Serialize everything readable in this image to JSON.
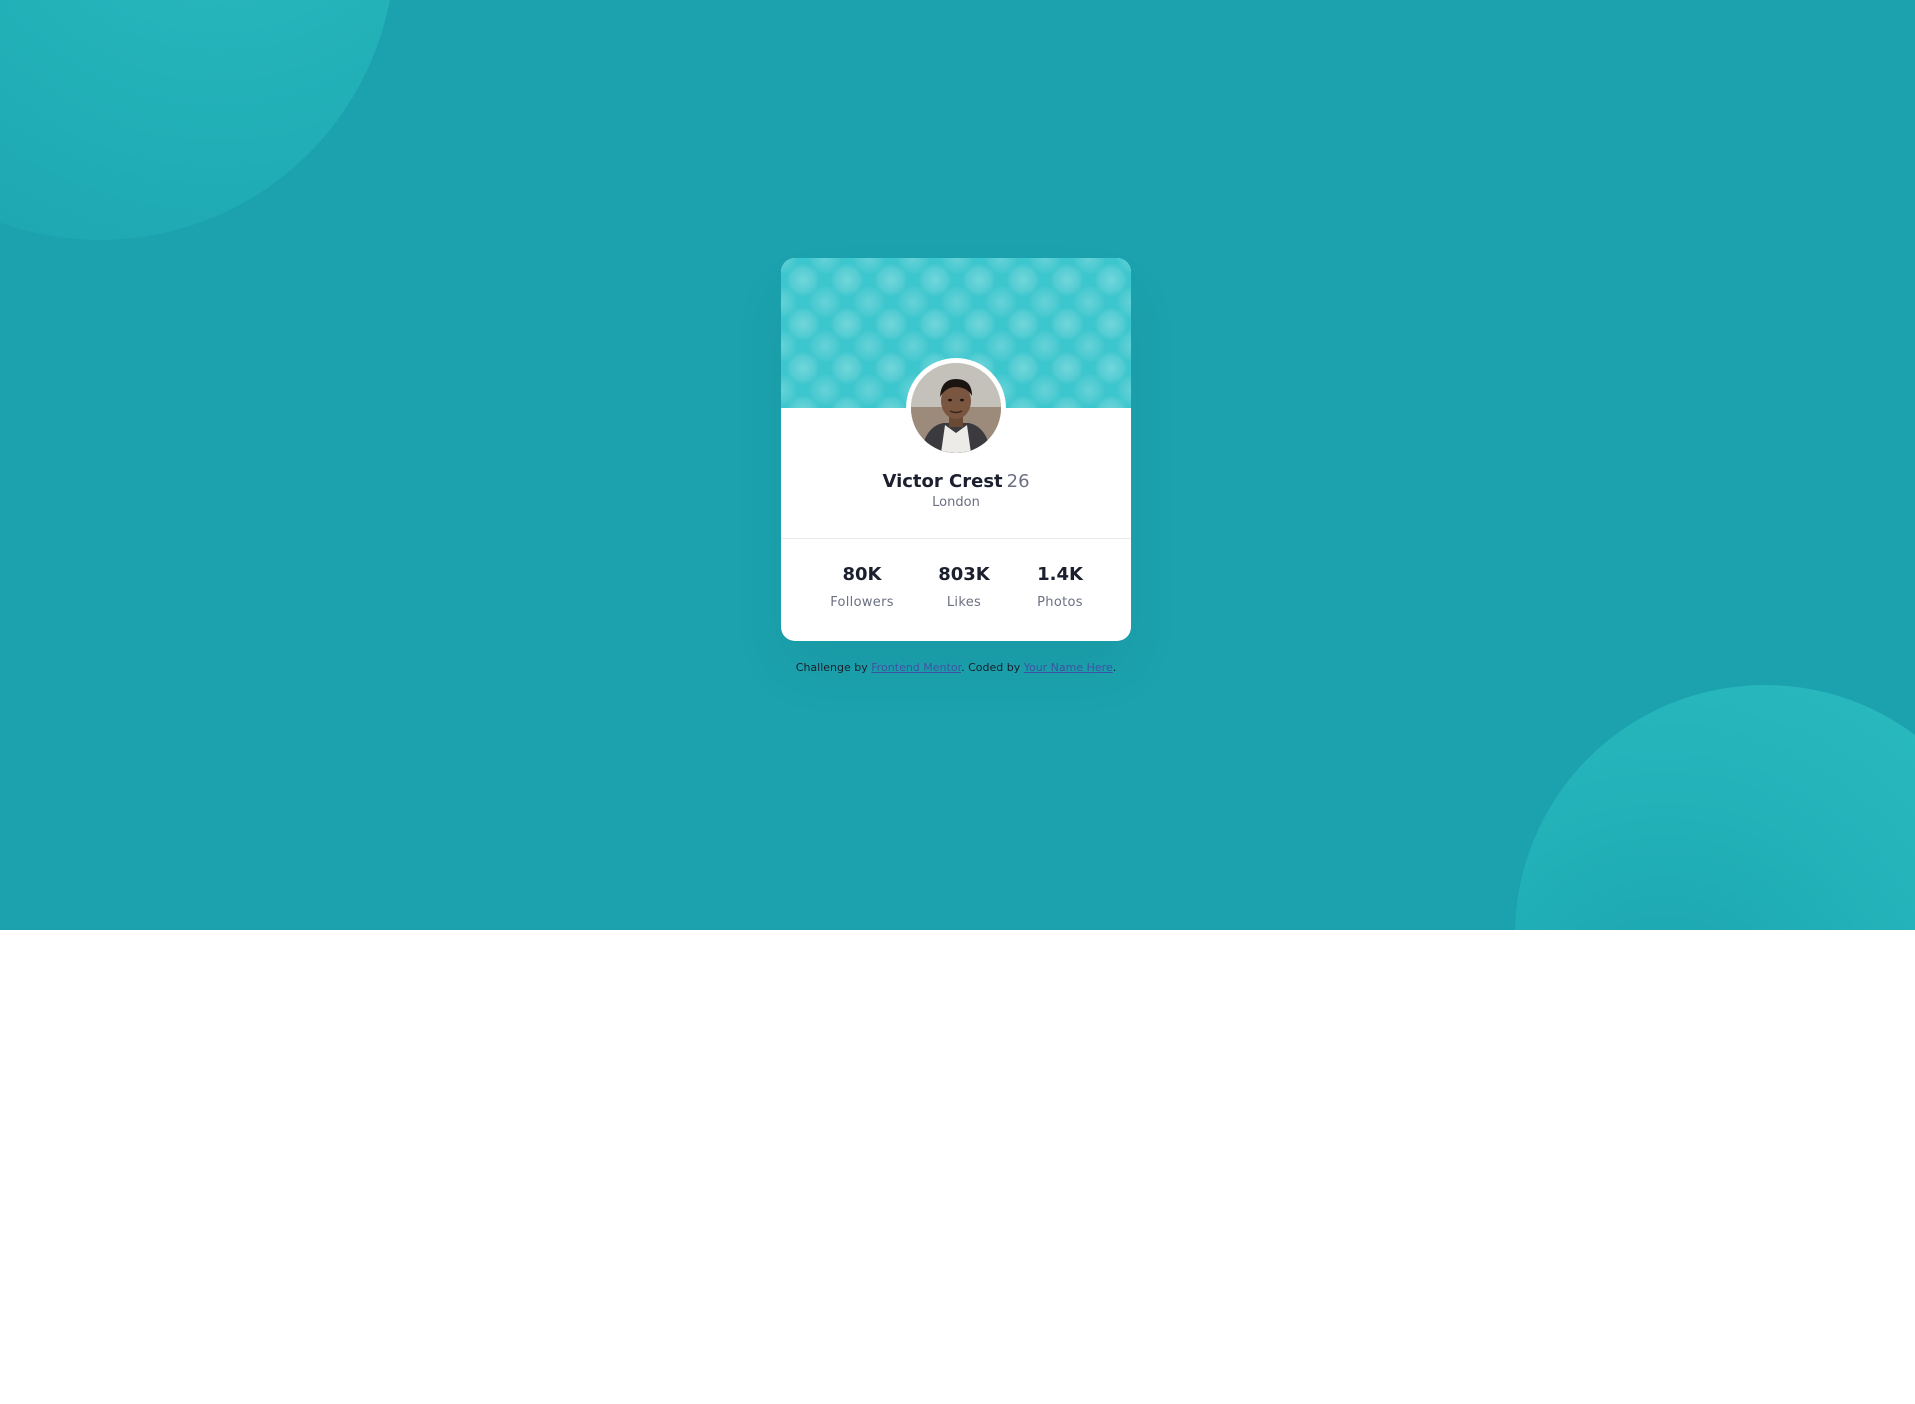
{
  "colors": {
    "page_background": "#1ba2ae",
    "card_header": "#3cc6cd",
    "card_background": "#ffffff",
    "text_dark": "#1c1f2e",
    "text_muted": "#6b7082",
    "link": "#3e52a3"
  },
  "profile": {
    "name": "Victor Crest",
    "age": "26",
    "location": "London",
    "avatar_icon": "profile-photo"
  },
  "stats": [
    {
      "value": "80K",
      "label": "Followers"
    },
    {
      "value": "803K",
      "label": "Likes"
    },
    {
      "value": "1.4K",
      "label": "Photos"
    }
  ],
  "attribution": {
    "prefix": "Challenge by",
    "link1_text": "Frontend Mentor",
    "middle": ". Coded by",
    "link2_text": "Your Name Here",
    "suffix": "."
  }
}
